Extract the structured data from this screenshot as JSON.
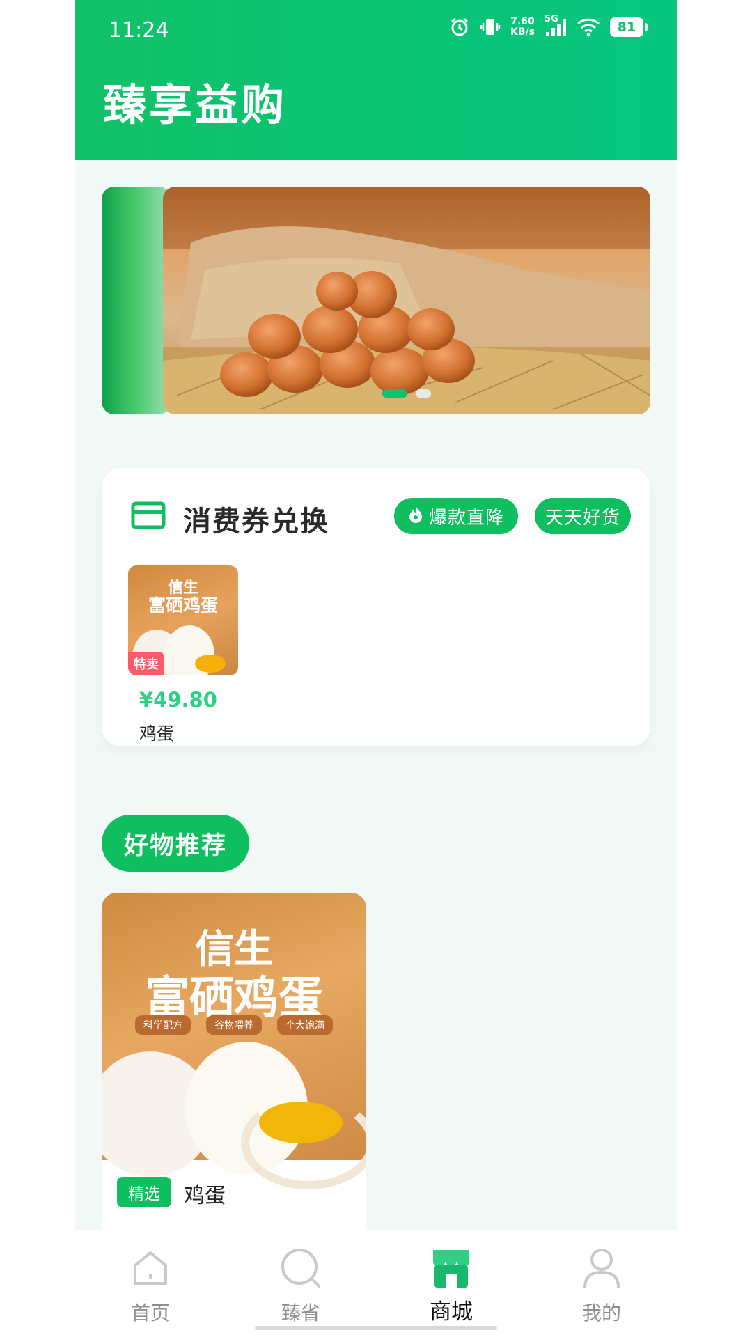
{
  "status_bar": {
    "time": "11:24",
    "net_speed_value": "7.60",
    "net_speed_unit": "KB/s",
    "network": "5G",
    "battery": "81"
  },
  "app": {
    "title": "臻享益购"
  },
  "banner": {
    "dots": 2,
    "active_index": 0
  },
  "coupon": {
    "title": "消费券兑换",
    "hot_label": "爆款直降",
    "daily_label": "天天好货",
    "product": {
      "image_line1": "信生",
      "image_line2": "富硒鸡蛋",
      "tag": "特卖",
      "price": "¥49.80",
      "name": "鸡蛋"
    }
  },
  "recommend": {
    "title": "好物推荐",
    "product": {
      "image_line1": "信生",
      "image_line2": "富硒鸡蛋",
      "chips": [
        "科学配方",
        "谷物喂养",
        "个大饱满"
      ],
      "tag": "精选",
      "name": "鸡蛋"
    }
  },
  "bottom_nav": {
    "items": [
      {
        "label": "首页",
        "icon": "home-icon"
      },
      {
        "label": "臻省",
        "icon": "search-icon"
      },
      {
        "label": "商城",
        "icon": "store-icon"
      },
      {
        "label": "我的",
        "icon": "user-icon"
      }
    ],
    "active_index": 2
  },
  "colors": {
    "brand_green": "#0fbf5f",
    "price_green": "#2ccf86",
    "sale_red": "#ff5a6a"
  }
}
